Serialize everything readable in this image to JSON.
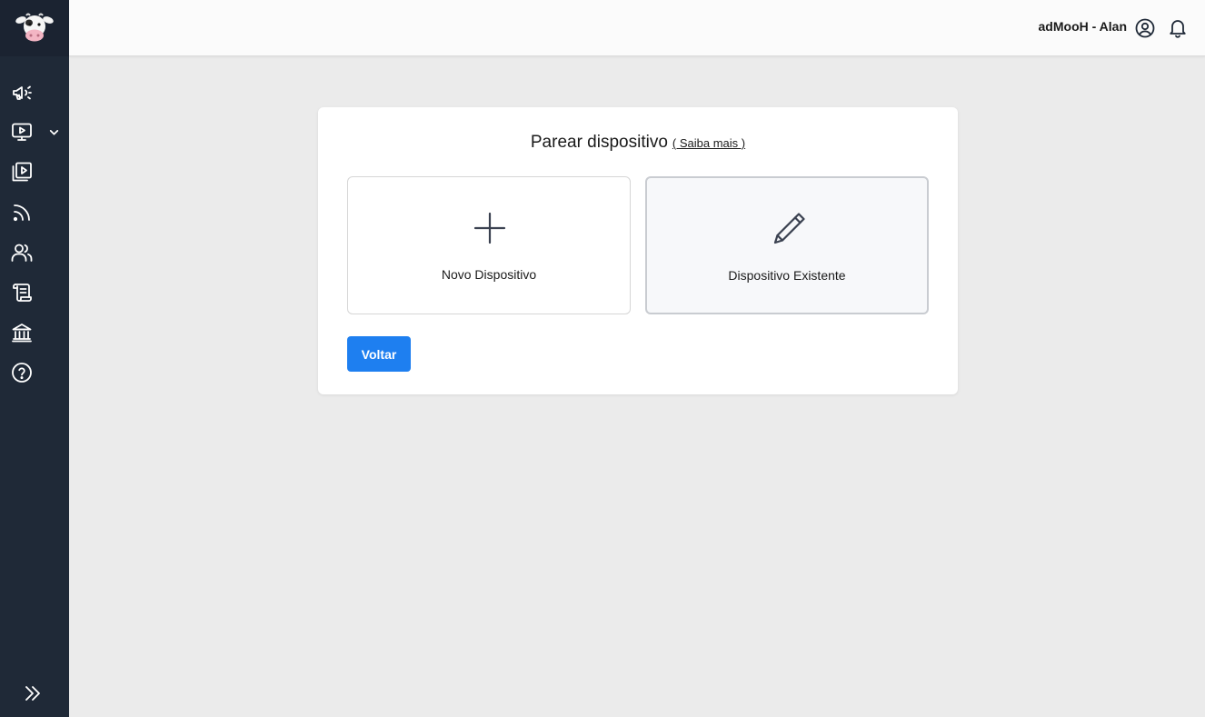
{
  "sidebar": {
    "logo_icon": "cow-logo-icon",
    "items": [
      {
        "icon": "megaphone-icon"
      },
      {
        "icon": "monitor-play-icon",
        "has_submenu": true
      },
      {
        "icon": "video-library-icon"
      },
      {
        "icon": "rss-feed-icon"
      },
      {
        "icon": "users-icon"
      },
      {
        "icon": "scroll-icon"
      },
      {
        "icon": "bank-icon"
      },
      {
        "icon": "help-circle-icon"
      }
    ],
    "expand_icon": "chevrons-right-icon"
  },
  "header": {
    "user_label": "adMooH - Alan",
    "user_icon": "user-circle-icon",
    "notification_icon": "bell-icon"
  },
  "card": {
    "title": "Parear dispositivo",
    "learn_more": "( Saiba mais )",
    "options": [
      {
        "label": "Novo Dispositivo",
        "icon": "plus-icon",
        "selected": false
      },
      {
        "label": "Dispositivo Existente",
        "icon": "pencil-icon",
        "selected": true
      }
    ],
    "back_button": "Voltar"
  },
  "colors": {
    "sidebar_bg": "#1f2937",
    "primary": "#1e7ff0",
    "page_bg": "#ebebeb"
  }
}
